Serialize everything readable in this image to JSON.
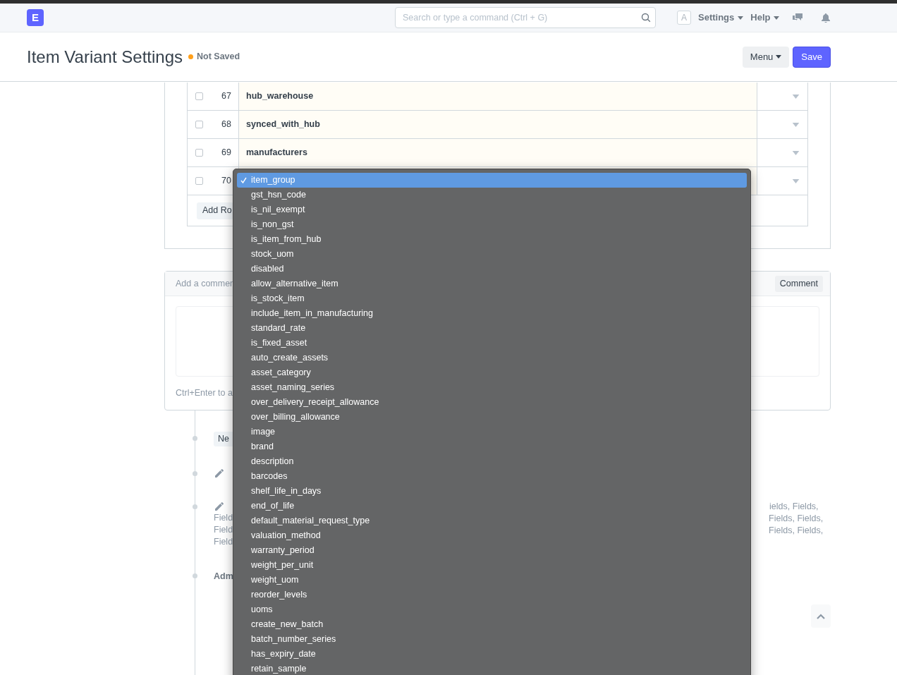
{
  "navbar": {
    "logo": "E",
    "search": {
      "placeholder": "Search or type a command (Ctrl + G)"
    },
    "avatar": "A",
    "menus": [
      "Settings",
      "Help"
    ]
  },
  "page_header": {
    "title": "Item Variant Settings",
    "status": "Not Saved",
    "buttons": [
      {
        "label": "Menu",
        "kind": "dropdown"
      },
      {
        "label": "Save",
        "kind": "primary"
      }
    ]
  },
  "table": {
    "rows": [
      {
        "checked": false,
        "index": "67",
        "field": "hub_warehouse"
      },
      {
        "checked": false,
        "index": "68",
        "field": "synced_with_hub"
      },
      {
        "checked": false,
        "index": "69",
        "field": "manufacturers"
      },
      {
        "checked": false,
        "index": "70"
      }
    ],
    "add_row": "Add Ro"
  },
  "comment": {
    "title": "Add a commen",
    "button": "Comment",
    "hint": "Ctrl+Enter to a"
  },
  "timeline": [
    {
      "kind": "button",
      "label": "Ne"
    },
    {
      "kind": "edit"
    },
    {
      "kind": "edit",
      "left_lines": [
        "Field",
        "Field",
        "Field"
      ],
      "right_lines": [
        "ields, Fields,",
        "Fields, Fields,",
        "Fields, Fields,"
      ]
    },
    {
      "kind": "text",
      "label": "Adm"
    }
  ],
  "dropdown": {
    "options": [
      {
        "label": "item_group",
        "selected": true
      },
      {
        "label": "gst_hsn_code",
        "selected": false
      },
      {
        "label": "is_nil_exempt",
        "selected": false
      },
      {
        "label": "is_non_gst",
        "selected": false
      },
      {
        "label": "is_item_from_hub",
        "selected": false
      },
      {
        "label": "stock_uom",
        "selected": false
      },
      {
        "label": "disabled",
        "selected": false
      },
      {
        "label": "allow_alternative_item",
        "selected": false
      },
      {
        "label": "is_stock_item",
        "selected": false
      },
      {
        "label": "include_item_in_manufacturing",
        "selected": false
      },
      {
        "label": "standard_rate",
        "selected": false
      },
      {
        "label": "is_fixed_asset",
        "selected": false
      },
      {
        "label": "auto_create_assets",
        "selected": false
      },
      {
        "label": "asset_category",
        "selected": false
      },
      {
        "label": "asset_naming_series",
        "selected": false
      },
      {
        "label": "over_delivery_receipt_allowance",
        "selected": false
      },
      {
        "label": "over_billing_allowance",
        "selected": false
      },
      {
        "label": "image",
        "selected": false
      },
      {
        "label": "brand",
        "selected": false
      },
      {
        "label": "description",
        "selected": false
      },
      {
        "label": "barcodes",
        "selected": false
      },
      {
        "label": "shelf_life_in_days",
        "selected": false
      },
      {
        "label": "end_of_life",
        "selected": false
      },
      {
        "label": "default_material_request_type",
        "selected": false
      },
      {
        "label": "valuation_method",
        "selected": false
      },
      {
        "label": "warranty_period",
        "selected": false
      },
      {
        "label": "weight_per_unit",
        "selected": false
      },
      {
        "label": "weight_uom",
        "selected": false
      },
      {
        "label": "reorder_levels",
        "selected": false
      },
      {
        "label": "uoms",
        "selected": false
      },
      {
        "label": "create_new_batch",
        "selected": false
      },
      {
        "label": "batch_number_series",
        "selected": false
      },
      {
        "label": "has_expiry_date",
        "selected": false
      },
      {
        "label": "retain_sample",
        "selected": false
      }
    ]
  }
}
